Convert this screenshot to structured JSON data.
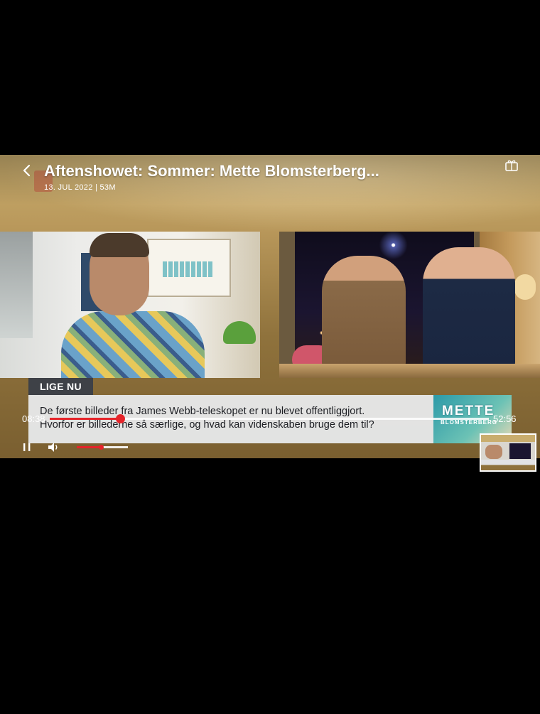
{
  "player": {
    "title": "Aftenshowet: Sommer: Mette Blomsterberg...",
    "meta": "13. JUL 2022 | 53M",
    "time_current": "08:38",
    "time_total": "52:56",
    "progress_fraction": 0.16,
    "volume_fraction": 0.47
  },
  "broadcast": {
    "lower_third_label": "LIGE NU",
    "ticker_line1": "De første billeder fra James Webb-teleskopet er nu blevet offentliggjort.",
    "ticker_line2": "Hvorfor er billederne så særlige, og hvad kan videnskaben bruge dem til?",
    "show_logo": "METTE",
    "show_logo_sub": "BLOMSTERBERG"
  },
  "icons": {
    "back": "chevron-left-icon",
    "cast": "chromecast-icon",
    "pause": "pause-icon",
    "volume": "volume-icon"
  },
  "colors": {
    "accent": "#e5242a",
    "label_bg": "#3e4147",
    "ticker_bg": "#e8eaec"
  }
}
